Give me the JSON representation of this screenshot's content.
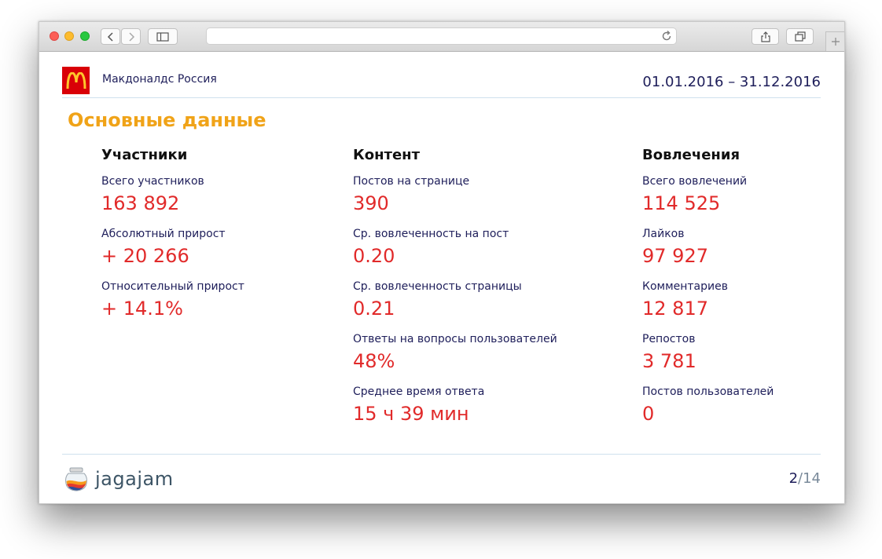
{
  "header": {
    "brand": "Макдоналдс Россия",
    "date_range": "01.01.2016 – 31.12.2016",
    "logo_letter": "M"
  },
  "section_title": "Основные данные",
  "columns": [
    {
      "title": "Участники",
      "metrics": [
        {
          "label": "Всего участников",
          "value": "163 892"
        },
        {
          "label": "Абсолютный прирост",
          "value": "+ 20 266"
        },
        {
          "label": "Относительный прирост",
          "value": "+ 14.1%"
        }
      ]
    },
    {
      "title": "Контент",
      "metrics": [
        {
          "label": "Постов на странице",
          "value": "390"
        },
        {
          "label": "Ср. вовлеченность на пост",
          "value": "0.20"
        },
        {
          "label": "Ср. вовлеченность страницы",
          "value": "0.21"
        },
        {
          "label": "Ответы на вопросы пользователей",
          "value": "48%"
        },
        {
          "label": "Среднее время ответа",
          "value": "15 ч 39 мин"
        }
      ]
    },
    {
      "title": "Вовлечения",
      "metrics": [
        {
          "label": "Всего вовлечений",
          "value": "114 525"
        },
        {
          "label": "Лайков",
          "value": "97 927"
        },
        {
          "label": "Комментариев",
          "value": "12 817"
        },
        {
          "label": "Репостов",
          "value": "3 781"
        },
        {
          "label": "Постов пользователей",
          "value": "0"
        }
      ]
    }
  ],
  "footer": {
    "logo_text": "jagajam",
    "page_current": "2",
    "page_total": "/14"
  },
  "colors": {
    "accent_orange": "#f0a318",
    "value_red": "#e12a2a",
    "label_navy": "#1e1e5a",
    "mcd_red": "#d90007",
    "mcd_yellow": "#ffc72c"
  },
  "icons": [
    "back-icon",
    "forward-icon",
    "sidebar-icon",
    "reload-icon",
    "share-icon",
    "tabs-icon",
    "new-tab-icon"
  ]
}
